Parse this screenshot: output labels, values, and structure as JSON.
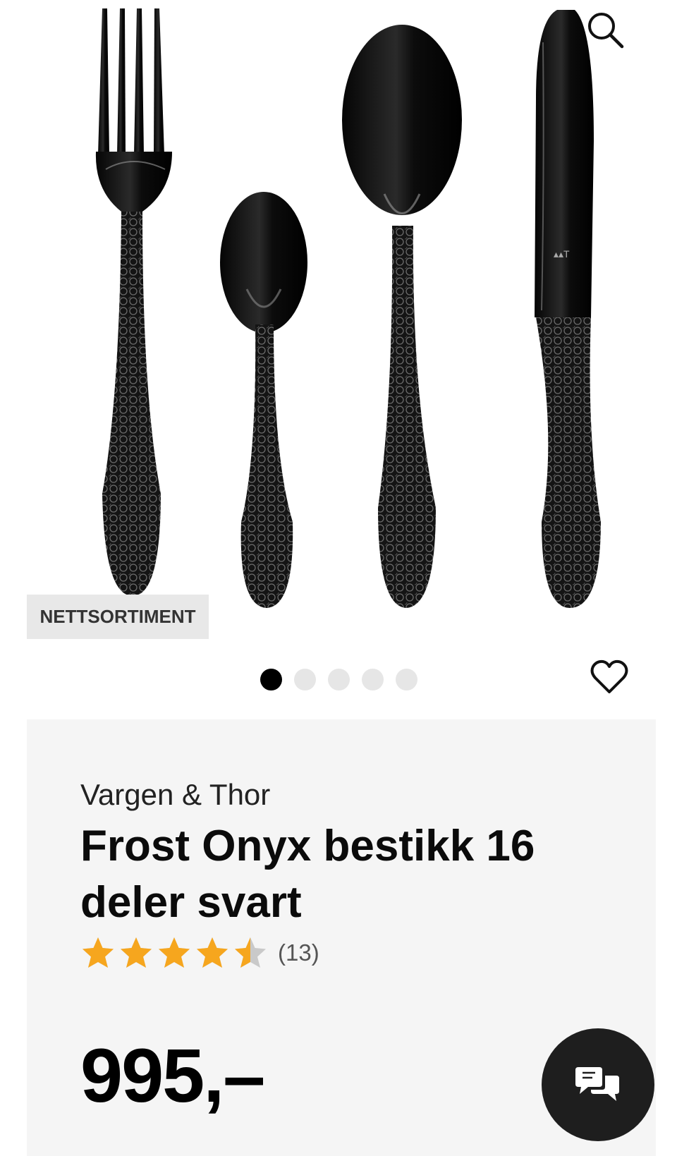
{
  "product_image": {
    "alt": "Frost Onyx bestikk 16 deler svart",
    "badge": "NETTSORTIMENT",
    "dots": 5,
    "active_dot": 0
  },
  "icons": {
    "search": "search-icon",
    "favorite": "heart-icon",
    "chat": "chat-icon"
  },
  "product": {
    "brand": "Vargen & Thor",
    "title": "Frost Onyx bestikk 16 deler svart",
    "rating": 4.5,
    "rating_count": "(13)",
    "price": "995,–"
  },
  "colors": {
    "star": "#F6A61E",
    "chat_bg": "#1e1e1e"
  }
}
